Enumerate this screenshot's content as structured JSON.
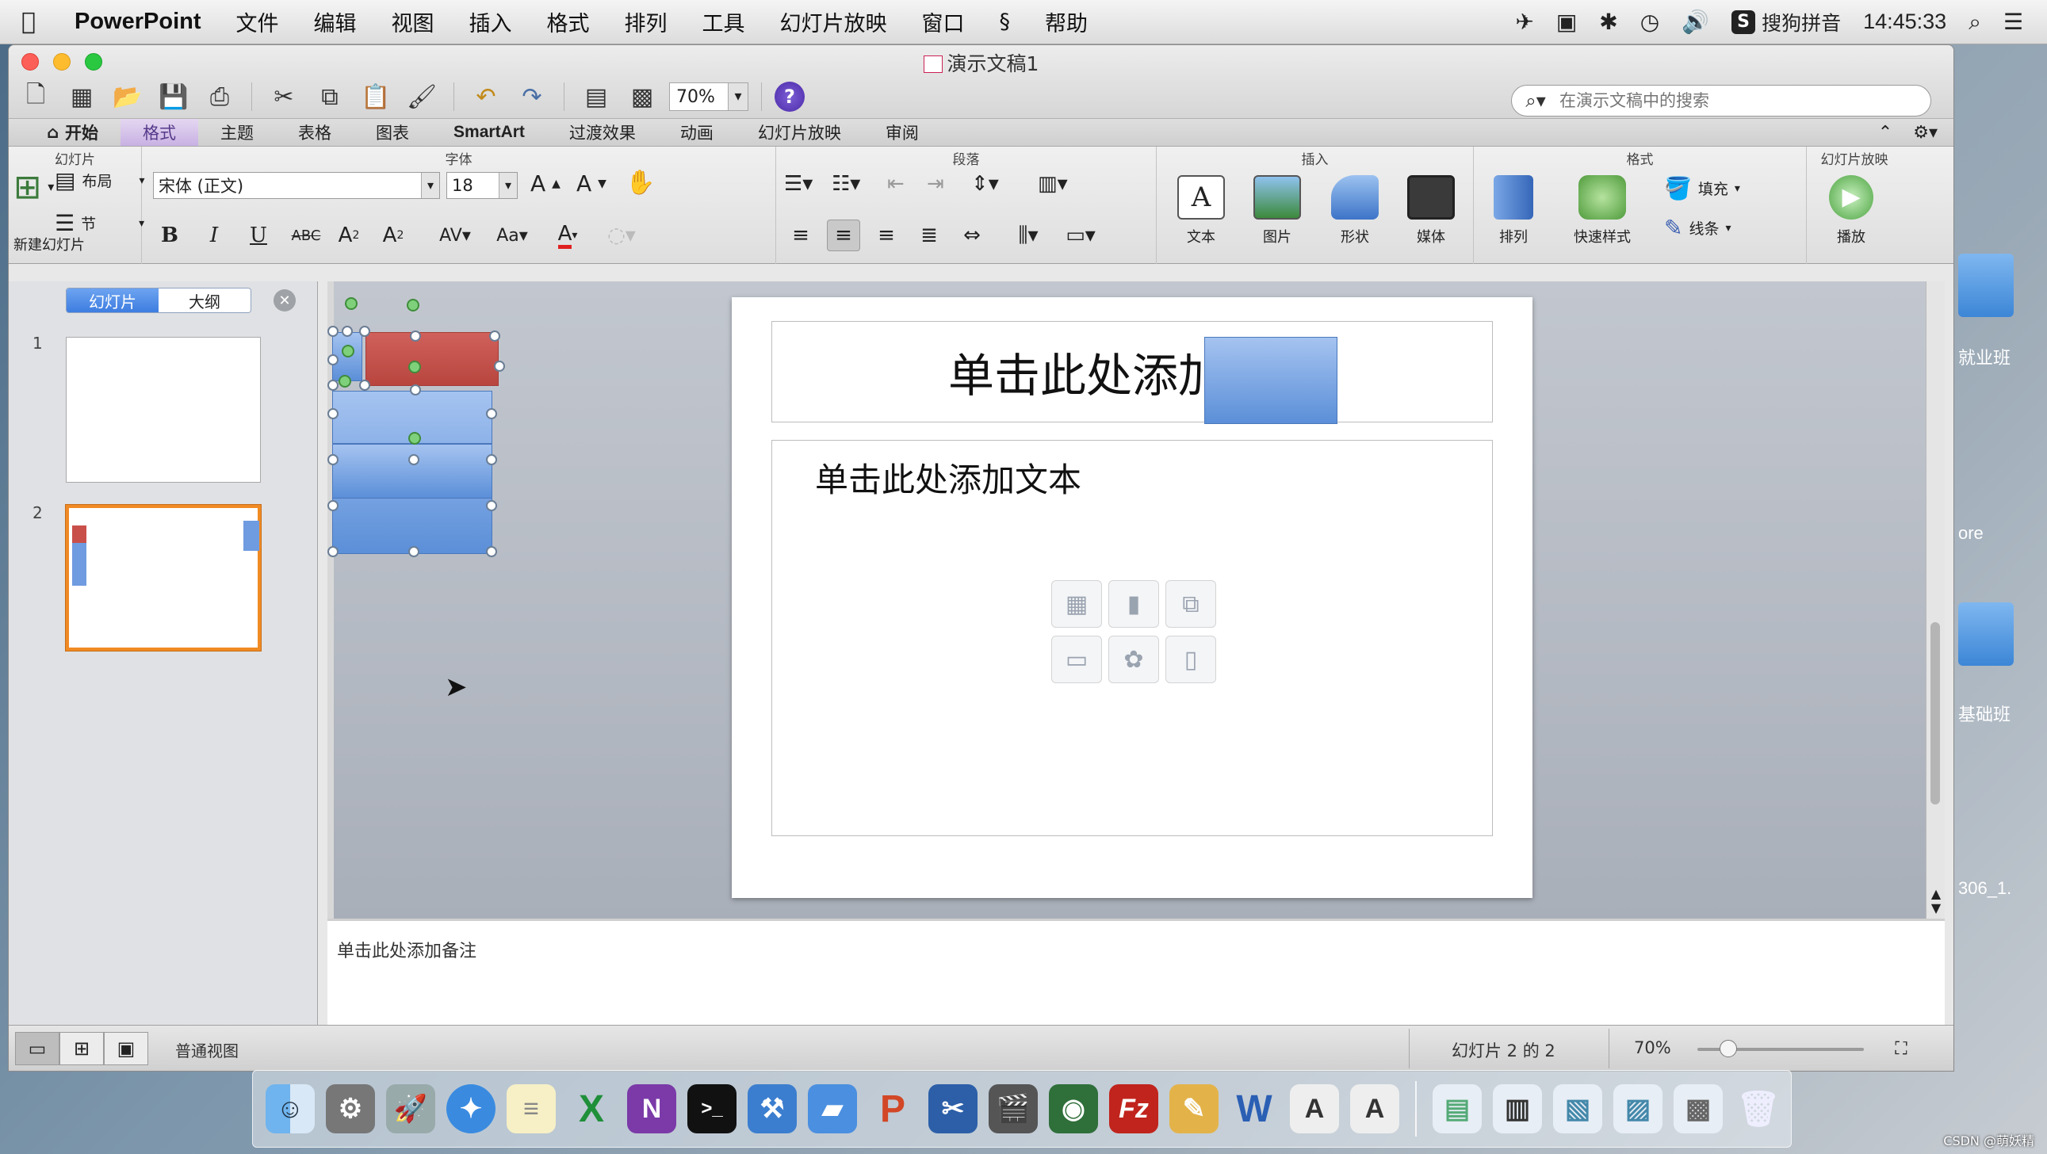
{
  "menubar": {
    "app_name": "PowerPoint",
    "items": [
      "文件",
      "编辑",
      "视图",
      "插入",
      "格式",
      "排列",
      "工具",
      "幻灯片放映",
      "窗口",
      "帮助"
    ],
    "input_method": "搜狗拼音",
    "clock": "14:45:33"
  },
  "window": {
    "title": "演示文稿1",
    "zoom": "70%",
    "search_placeholder": "在演示文稿中的搜索"
  },
  "ribbon_tabs": {
    "home": "开始",
    "format": "格式",
    "theme": "主题",
    "tables": "表格",
    "charts": "图表",
    "smartart": "SmartArt",
    "transitions": "过渡效果",
    "animations": "动画",
    "slideshow": "幻灯片放映",
    "review": "审阅"
  },
  "ribbon": {
    "groups": {
      "slides": "幻灯片",
      "font": "字体",
      "paragraph": "段落",
      "insert": "插入",
      "format": "格式",
      "slideshow": "幻灯片放映"
    },
    "new_slide": "新建幻灯片",
    "layout": "布局",
    "section": "节",
    "font_name": "宋体 (正文)",
    "font_size": "18",
    "insert_text": "文本",
    "insert_picture": "图片",
    "insert_shape": "形状",
    "insert_media": "媒体",
    "arrange": "排列",
    "quick_styles": "快速样式",
    "fill": "填充",
    "line": "线条",
    "play": "播放"
  },
  "left_pane": {
    "tab_slides": "幻灯片",
    "tab_outline": "大纲",
    "slide_numbers": [
      "1",
      "2"
    ]
  },
  "slide": {
    "title_placeholder": "单击此处添加标题",
    "body_placeholder": "单击此处添加文本"
  },
  "notes": {
    "placeholder": "单击此处添加备注"
  },
  "statusbar": {
    "view_label": "普通视图",
    "slide_indicator": "幻灯片 2 的 2",
    "zoom": "70%"
  },
  "desktop": {
    "label_1": "就业班",
    "label_2": "ore",
    "label_3": "基础班",
    "label_4": "306_1."
  },
  "watermark": "CSDN @萌妖精"
}
